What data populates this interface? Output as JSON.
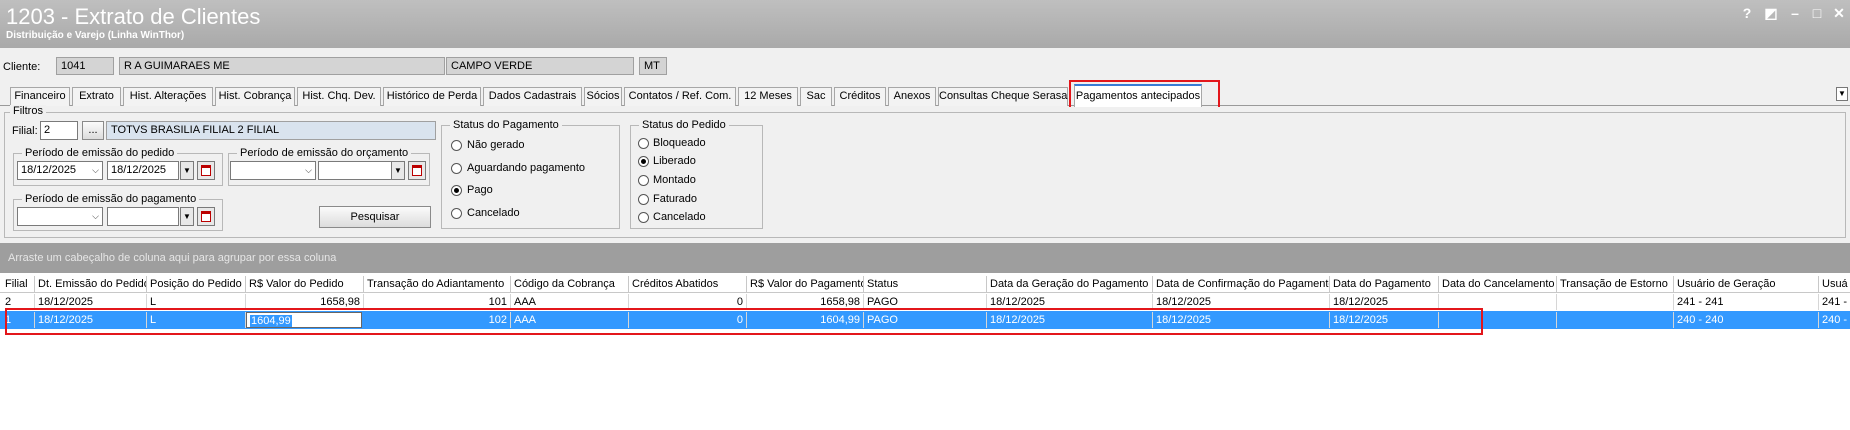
{
  "window": {
    "title": "1203 - Extrato de Clientes",
    "subtitle": "Distribuição e Varejo (Linha WinThor)",
    "controls": [
      "?",
      "◩",
      "–",
      "□",
      "✕"
    ]
  },
  "client": {
    "label": "Cliente:",
    "code": "1041",
    "name": "R A GUIMARAES ME",
    "city": "CAMPO VERDE",
    "state": "MT"
  },
  "tabs": [
    "Financeiro",
    "Extrato",
    "Hist. Alterações",
    "Hist. Cobrança",
    "Hist. Chq. Dev.",
    "Histórico de Perda",
    "Dados Cadastrais",
    "Sócios",
    "Contatos / Ref. Com.",
    "12 Meses",
    "Sac",
    "Créditos",
    "Anexos",
    "Consultas Cheque Serasa",
    "Pagamentos antecipados"
  ],
  "active_tab": "Pagamentos antecipados",
  "filters": {
    "group_label": "Filtros",
    "filial_label": "Filial:",
    "filial_value": "2",
    "filial_btn": "...",
    "filial_name": "TOTVS BRASILIA FILIAL 2 FILIAL",
    "pedido_period_label": "Período de emissão do pedido",
    "pedido_from": "18/12/2025",
    "pedido_to": "18/12/2025",
    "orcamento_period_label": "Período de emissão do orçamento",
    "orcamento_from": "",
    "orcamento_to": "",
    "pagamento_period_label": "Período de emissão do pagamento",
    "pagamento_from": "",
    "pagamento_to": "",
    "search_button": "Pesquisar",
    "status_pagamento": {
      "label": "Status do Pagamento",
      "options": [
        "Não gerado",
        "Aguardando pagamento",
        "Pago",
        "Cancelado"
      ],
      "selected": "Pago"
    },
    "status_pedido": {
      "label": "Status do Pedido",
      "options": [
        "Bloqueado",
        "Liberado",
        "Montado",
        "Faturado",
        "Cancelado"
      ],
      "selected": "Liberado"
    }
  },
  "group_hint": "Arraste um cabeçalho de coluna aqui para agrupar por essa coluna",
  "table": {
    "columns": [
      "Filial",
      "Dt. Emissão do Pedido",
      "Posição do Pedido",
      "R$ Valor do Pedido",
      "Transação do Adiantamento",
      "Código da Cobrança",
      "Créditos Abatidos",
      "R$ Valor do Pagamento",
      "Status",
      "Data da Geração do Pagamento",
      "Data de Confirmação do Pagamento",
      "Data do Pagamento",
      "Data do Cancelamento",
      "Transação de Estorno",
      "Usuário de Geração",
      "Usuá"
    ],
    "rows": [
      [
        "2",
        "18/12/2025",
        "L",
        "1658,98",
        "101",
        "AAA",
        "0",
        "1658,98",
        "PAGO",
        "18/12/2025",
        "18/12/2025",
        "18/12/2025",
        "",
        "",
        "241 - 241",
        "241 -"
      ],
      [
        "1",
        "18/12/2025",
        "L",
        "1604,99",
        "102",
        "AAA",
        "0",
        "1604,99",
        "PAGO",
        "18/12/2025",
        "18/12/2025",
        "18/12/2025",
        "",
        "",
        "240 - 240",
        "240 -"
      ]
    ]
  },
  "colors": {
    "title_bar": "#a9a9a9",
    "selected_row": "#3399ff",
    "highlight": "#e3161b",
    "group_bar": "#9e9e9e"
  }
}
